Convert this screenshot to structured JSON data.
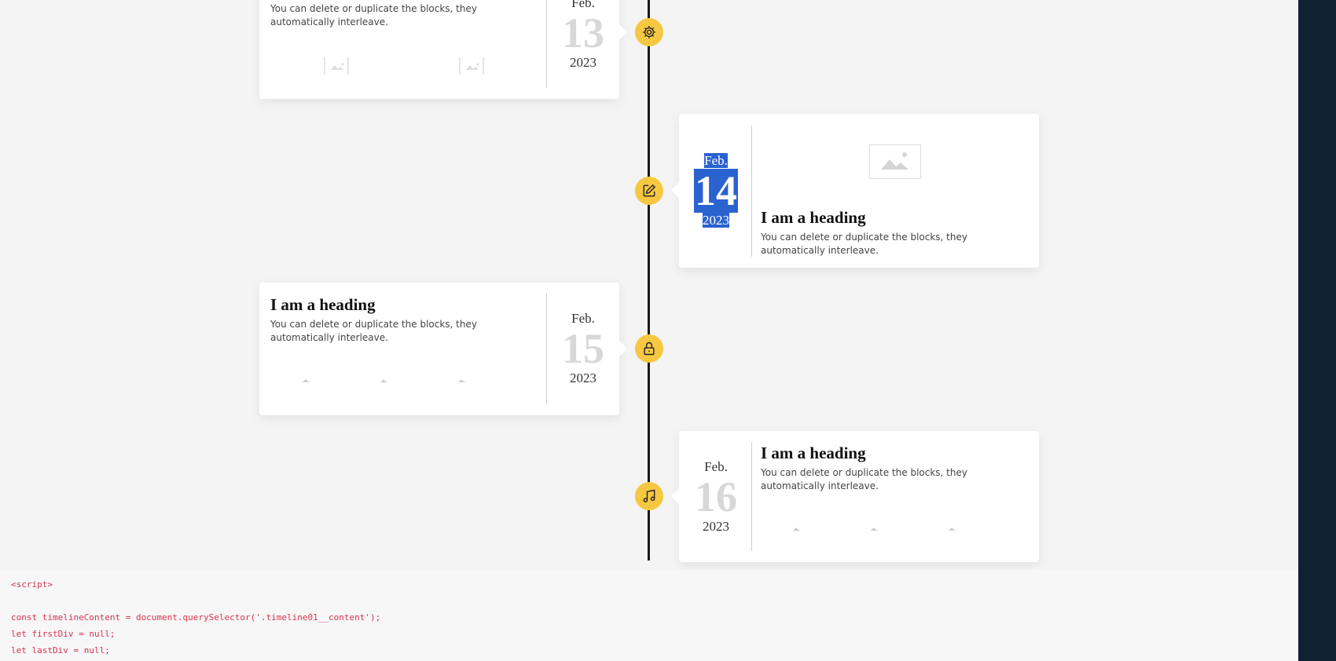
{
  "timeline": {
    "entries": [
      {
        "month": "Feb.",
        "day": "13",
        "year": "2023",
        "text": "You can delete or duplicate the blocks, they automatically interleave.",
        "icon": "gear-icon"
      },
      {
        "month": "Feb.",
        "day": "14",
        "year": "2023",
        "heading": "I am a heading",
        "text": "You can delete or duplicate the blocks, they automatically interleave.",
        "icon": "edit-icon"
      },
      {
        "month": "Feb.",
        "day": "15",
        "year": "2023",
        "heading": "I am a heading",
        "text": "You can delete or duplicate the blocks, they automatically interleave.",
        "icon": "lock-icon"
      },
      {
        "month": "Feb.",
        "day": "16",
        "year": "2023",
        "heading": "I am a heading",
        "text": "You can delete or duplicate the blocks, they automatically interleave.",
        "icon": "music-icon"
      }
    ]
  },
  "code": {
    "lines": [
      "<script>",
      "const timelineContent = document.querySelector('.timeline01__content');",
      "let firstDiv = null;",
      "let lastDiv = null;"
    ]
  },
  "colors": {
    "accent": "#f6c842",
    "selection": "#2a63d0",
    "code_text": "#d9324a",
    "side_panel": "#0f2133"
  }
}
